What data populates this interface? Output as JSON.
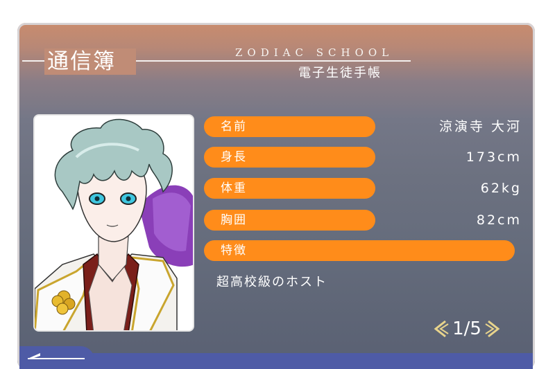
{
  "header": {
    "title": "通信簿",
    "subtitle_en": "ZODIAC SCHOOL",
    "subtitle_jp": "電子生徒手帳"
  },
  "profile": {
    "rows": [
      {
        "label": "名前",
        "value": "涼演寺 大河"
      },
      {
        "label": "身長",
        "value": "173cm"
      },
      {
        "label": "体重",
        "value": "62kg"
      },
      {
        "label": "胸囲",
        "value": "82cm"
      }
    ],
    "feature_label": "特徴",
    "feature_text": "超高校級のホスト"
  },
  "pager": {
    "current": "1/5",
    "prev_icon": "chevron-left-icon",
    "next_icon": "chevron-right-icon"
  },
  "footer": {
    "back_icon": "back-arrow-icon"
  },
  "colors": {
    "accent": "#ff8c1a",
    "nav_bar": "#4e5ba6",
    "arrow_gold": "#e8d48c"
  }
}
